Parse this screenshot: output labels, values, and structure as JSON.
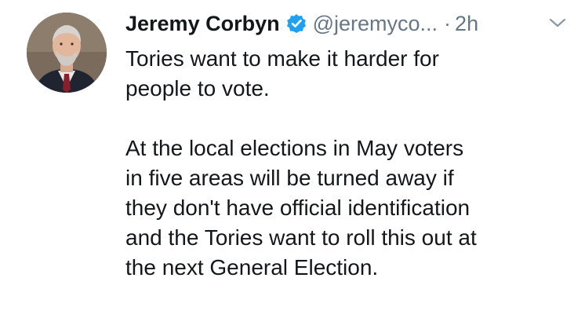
{
  "tweet": {
    "display_name": "Jeremy Corbyn",
    "handle": "@jeremyco...",
    "separator": "·",
    "time": "2h",
    "verified": true,
    "icons": {
      "verified": "verified-badge-icon",
      "caret": "chevron-down-icon"
    },
    "colors": {
      "verified": "#1da1f2",
      "secondary_text": "#657786",
      "primary_text": "#14171a"
    },
    "paragraphs": [
      "Tories want to make it harder for\npeople to vote.",
      "At the local elections in May voters\nin five areas will be turned away if\nthey don't have official identification\nand the Tories want to roll this out at\nthe next General Election."
    ]
  }
}
